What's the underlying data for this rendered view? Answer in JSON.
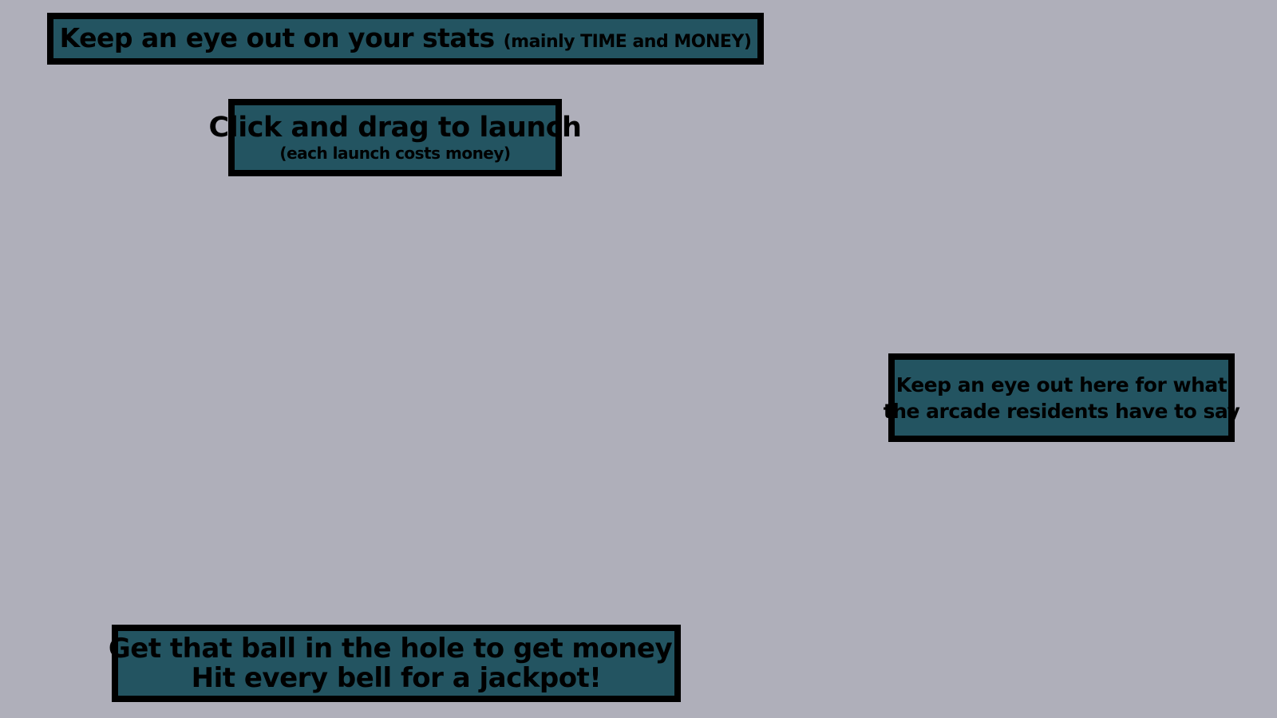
{
  "tips": {
    "stats": {
      "main": "Keep an eye out on your stats",
      "note": "(mainly TIME and MONEY)"
    },
    "launch": {
      "title": "Click and drag to launch",
      "note": "(each launch costs money)"
    },
    "residents": {
      "line1": "Keep an eye out here for what",
      "line2": "the arcade residents have to say"
    },
    "money": {
      "line1": "Get that ball in the hole to get money!",
      "line2": "Hit every bell for a jackpot!"
    }
  },
  "colors": {
    "background": "#afafba",
    "box_fill": "#235461",
    "box_border": "#000000",
    "text": "#000000"
  }
}
